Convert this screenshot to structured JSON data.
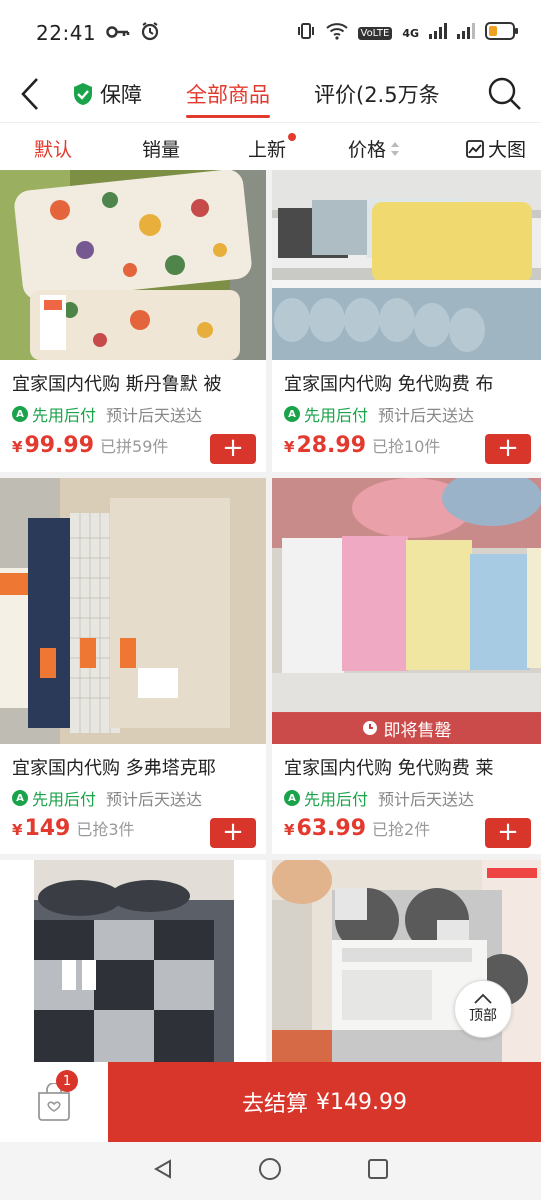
{
  "status_bar": {
    "time": "22:41",
    "network": "4G",
    "volte": "VoLTE"
  },
  "nav": {
    "guarantee_label": "保障",
    "all_products_label": "全部商品",
    "reviews_label": "评价(2.5万条"
  },
  "sort_bar": {
    "default": "默认",
    "sales": "销量",
    "new": "上新",
    "price": "价格",
    "big_image": "大图"
  },
  "products": [
    {
      "title": "宜家国内代购 斯丹鲁默 被",
      "pay_tag": "先用后付",
      "delivery": "预计后天送达",
      "currency": "¥",
      "price": "99.99",
      "sold": "已拼59件"
    },
    {
      "title": "宜家国内代购 免代购费 布",
      "pay_tag": "先用后付",
      "delivery": "预计后天送达",
      "currency": "¥",
      "price": "28.99",
      "sold": "已抢10件"
    },
    {
      "title": "宜家国内代购 多弗塔克耶",
      "pay_tag": "先用后付",
      "delivery": "预计后天送达",
      "currency": "¥",
      "price": "149",
      "sold": "已抢3件"
    },
    {
      "title": "宜家国内代购 免代购费 莱",
      "pay_tag": "先用后付",
      "delivery": "预计后天送达",
      "currency": "¥",
      "price": "63.99",
      "sold": "已抢2件",
      "overlay": "即将售罄"
    }
  ],
  "top_button": "顶部",
  "bottom_bar": {
    "cart_count": "1",
    "checkout_label": "去结算",
    "checkout_amount": "¥149.99"
  },
  "colors": {
    "accent": "#e23a2e",
    "button": "#d8352b",
    "pay_green": "#1aa34a"
  }
}
